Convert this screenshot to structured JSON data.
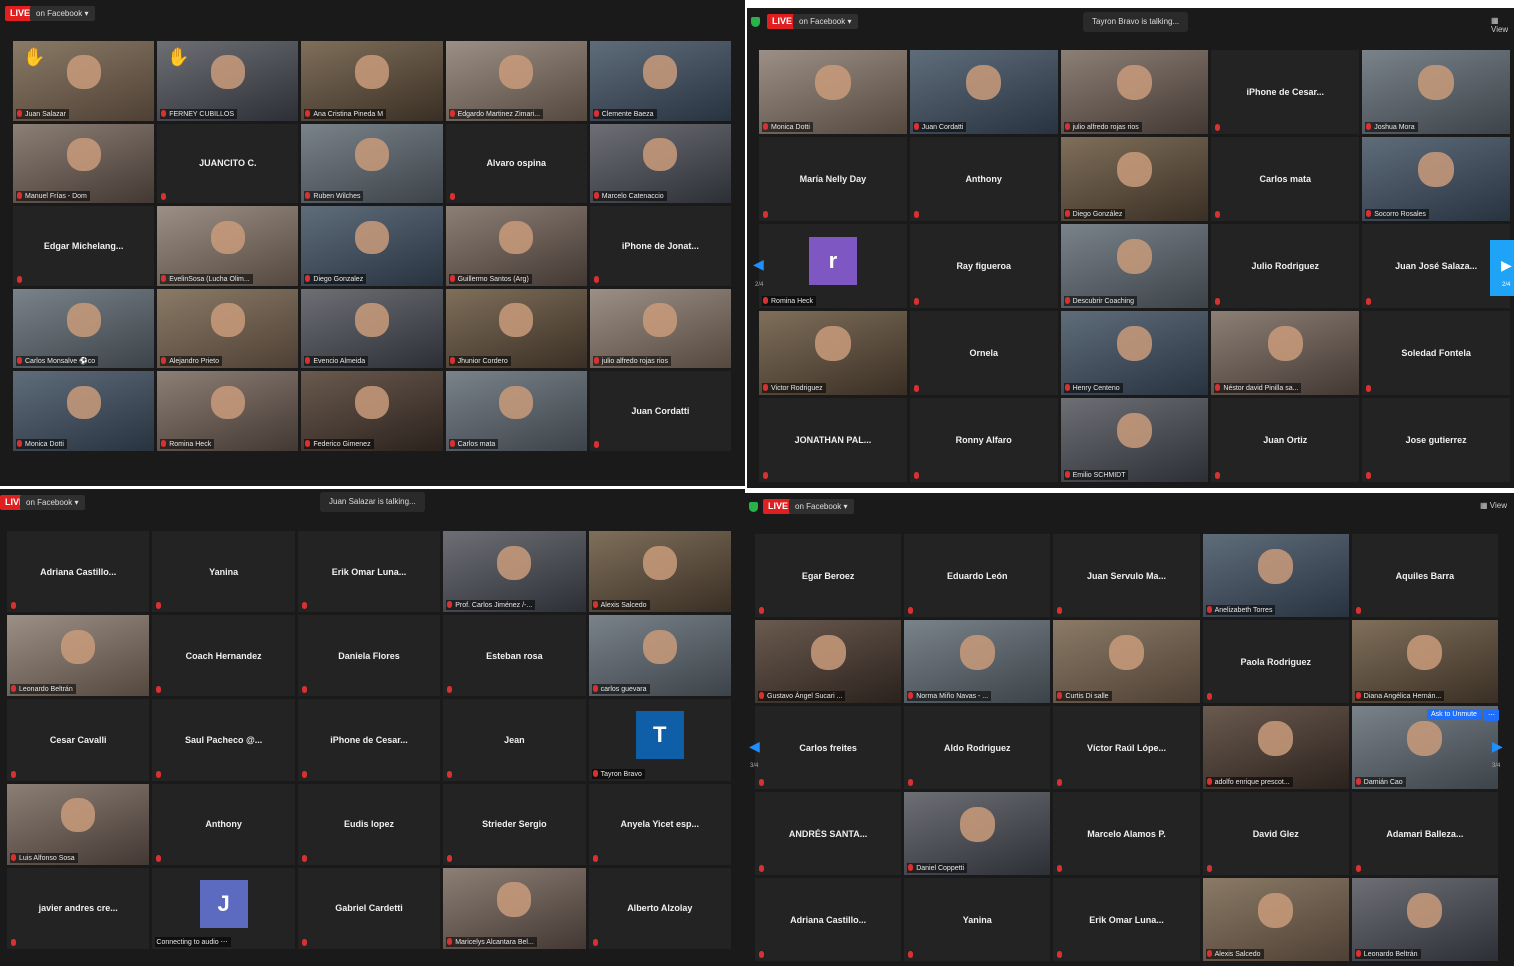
{
  "panels": [
    {
      "live": "LIVE",
      "facebook": "on Facebook",
      "talking": "",
      "view": "",
      "tiles": [
        {
          "label": "Juan Salazar",
          "photo": true,
          "hand": true,
          "speaking": true
        },
        {
          "label": "FERNEY CUBILLOS",
          "photo": true,
          "hand": true
        },
        {
          "label": "Ana Cristina Pineda M",
          "photo": true
        },
        {
          "label": "Edgardo Martinez Zimari...",
          "photo": true
        },
        {
          "label": "Clemente Baeza",
          "photo": true
        },
        {
          "label": "Manuel Frías - Dom",
          "photo": true
        },
        {
          "name": "JUANCITO C."
        },
        {
          "label": "Ruben Wilches",
          "photo": true
        },
        {
          "name": "Alvaro ospina"
        },
        {
          "label": "Marcelo Catenaccio",
          "photo": true
        },
        {
          "name": "Edgar Michelang..."
        },
        {
          "label": "EvelinSosa (Lucha Olim...",
          "photo": true
        },
        {
          "label": "Diego Gonzalez",
          "photo": true
        },
        {
          "label": "Guillermo Santos (Arg)",
          "photo": true
        },
        {
          "name": "iPhone de Jonat..."
        },
        {
          "label": "Carlos Monsalve ⚽co",
          "photo": true
        },
        {
          "label": "Alejandro Prieto",
          "photo": true
        },
        {
          "label": "Evencio Almeida",
          "photo": true
        },
        {
          "label": "Jhunior Cordero",
          "photo": true
        },
        {
          "label": "julio alfredo rojas rios",
          "photo": true
        },
        {
          "label": "Monica Dotti",
          "photo": true
        },
        {
          "label": "Romina Heck",
          "photo": true
        },
        {
          "label": "Federico Gimenez",
          "photo": true
        },
        {
          "label": "Carlos mata",
          "photo": true
        },
        {
          "name": "Juan Cordatti"
        }
      ]
    },
    {
      "live": "LIVE",
      "facebook": "on Facebook",
      "talking": "Tayron Bravo is talking...",
      "view": "View",
      "page_left": "2/4",
      "page_right": "2/4",
      "tiles": [
        {
          "label": "Monica Dotti",
          "photo": true
        },
        {
          "label": "Juan Cordatti",
          "photo": true
        },
        {
          "label": "julio alfredo rojas rios",
          "photo": true
        },
        {
          "name": "iPhone de Cesar..."
        },
        {
          "label": "Joshua Mora",
          "photo": true
        },
        {
          "name": "María Nelly Day"
        },
        {
          "name": "Anthony"
        },
        {
          "label": "Diego González",
          "photo": true
        },
        {
          "name": "Carlos mata"
        },
        {
          "label": "Socorro Rosales",
          "photo": true
        },
        {
          "label": "Romina Heck",
          "avatar": "r",
          "avatar_color": "#7e57c2"
        },
        {
          "name": "Ray figueroa"
        },
        {
          "label": "Descubrir Coaching",
          "photo": true
        },
        {
          "name": "Julio Rodriguez"
        },
        {
          "name": "Juan José Salaza..."
        },
        {
          "label": "Victor Rodriguez",
          "photo": true
        },
        {
          "name": "Ornela"
        },
        {
          "label": "Henry Centeno",
          "photo": true
        },
        {
          "label": "Néstor david Pinilla sa...",
          "photo": true
        },
        {
          "name": "Soledad Fontela"
        },
        {
          "name": "JONATHAN PAL..."
        },
        {
          "name": "Ronny Alfaro"
        },
        {
          "label": "Emilio SCHMIDT",
          "photo": true
        },
        {
          "name": "Juan Ortiz"
        },
        {
          "name": "Jose gutierrez"
        }
      ]
    },
    {
      "live": "LIVE",
      "facebook": "on Facebook",
      "talking": "Juan Salazar is talking...",
      "view": "",
      "tiles": [
        {
          "name": "Adriana Castillo..."
        },
        {
          "name": "Yanina"
        },
        {
          "name": "Erik Omar Luna..."
        },
        {
          "label": "Prof. Carlos Jiménez /-...",
          "photo": true
        },
        {
          "label": "Alexis Salcedo",
          "photo": true
        },
        {
          "label": "Leonardo Beltrán",
          "photo": true
        },
        {
          "name": "Coach Hernandez"
        },
        {
          "name": "Daniela Flores"
        },
        {
          "name": "Esteban rosa"
        },
        {
          "label": "carlos guevara",
          "photo": true
        },
        {
          "name": "Cesar Cavalli"
        },
        {
          "name": "Saul Pacheco @..."
        },
        {
          "name": "iPhone de Cesar..."
        },
        {
          "name": "Jean"
        },
        {
          "label": "Tayron Bravo",
          "avatar": "T",
          "avatar_color": "#0f5ea8"
        },
        {
          "label": "Luis Alfonso Sosa",
          "photo": true
        },
        {
          "name": "Anthony"
        },
        {
          "name": "Eudis lopez"
        },
        {
          "name": "Strieder Sergio"
        },
        {
          "name": "Anyela Yicet esp..."
        },
        {
          "name": "javier andres cre..."
        },
        {
          "label": "Connecting to audio ⋯",
          "avatar": "J",
          "avatar_color": "#5c6bc0",
          "nomic": true
        },
        {
          "name": "Gabriel Cardetti"
        },
        {
          "label": "Maricelys Alcantara Bel...",
          "photo": true
        },
        {
          "name": "Alberto Alzolay"
        }
      ]
    },
    {
      "live": "LIVE",
      "facebook": "on Facebook",
      "talking": "",
      "view": "View",
      "page_left": "3/4",
      "page_right": "3/4",
      "unmute": "Ask to Unmute",
      "unmute_more": "⋯",
      "tiles": [
        {
          "name": "Egar Beroez"
        },
        {
          "name": "Eduardo León"
        },
        {
          "name": "Juan Servulo Ma..."
        },
        {
          "label": "Anelizabeth Torres",
          "photo": true
        },
        {
          "name": "Aquiles Barra"
        },
        {
          "label": "Gustavo Ángel Sucari ...",
          "photo": true
        },
        {
          "label": "Norma Miño Navas - ...",
          "photo": true
        },
        {
          "label": "Curtis Di salle",
          "photo": true
        },
        {
          "name": "Paola Rodriguez"
        },
        {
          "label": "Diana Angélica Hernán...",
          "photo": true
        },
        {
          "name": "Carlos freites"
        },
        {
          "name": "Aldo Rodriguez"
        },
        {
          "name": "Víctor Raúl Lópe..."
        },
        {
          "label": "adolfo enrique prescot...",
          "photo": true
        },
        {
          "label": "Damián Cao",
          "photo": true
        },
        {
          "name": "ANDRÉS SANTA..."
        },
        {
          "label": "Daniel Coppetti",
          "photo": true
        },
        {
          "name": "Marcelo Alamos P."
        },
        {
          "name": "David Glez"
        },
        {
          "name": "Adamari Balleza..."
        },
        {
          "name": "Adriana Castillo..."
        },
        {
          "name": "Yanina"
        },
        {
          "name": "Erik Omar Luna..."
        },
        {
          "label": "Alexis Salcedo",
          "photo": true
        },
        {
          "label": "Leonardo Beltrán",
          "photo": true
        }
      ]
    }
  ]
}
